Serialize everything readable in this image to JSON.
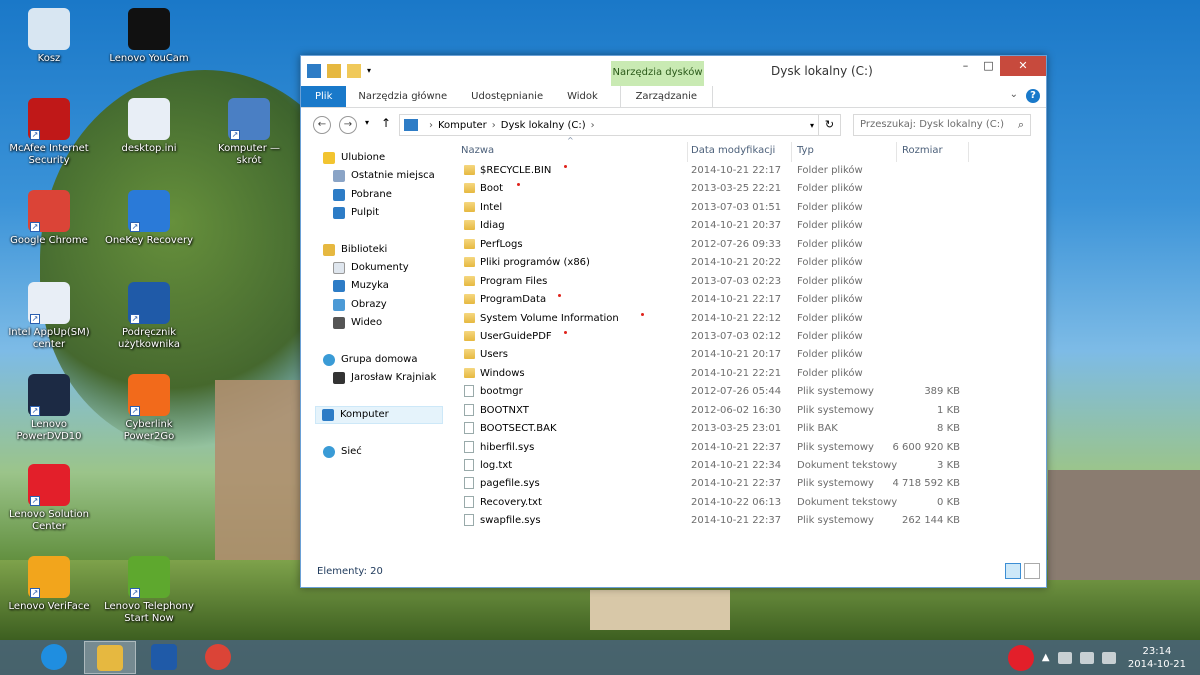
{
  "desktop": {
    "icons": [
      {
        "label": "Kosz",
        "color": "#d8e6f2"
      },
      {
        "label": "Lenovo YouCam",
        "color": "#111111"
      },
      {
        "label": "McAfee Internet Security",
        "color": "#c01818"
      },
      {
        "label": "desktop.ini",
        "color": "#e8eef6"
      },
      {
        "label": "Komputer — skrót",
        "color": "#4a7fc4"
      },
      {
        "label": "Google Chrome",
        "color": "#db4437"
      },
      {
        "label": "OneKey Recovery",
        "color": "#2a7ad8"
      },
      {
        "label": "Intel AppUp(SM) center",
        "color": "#e8eef6"
      },
      {
        "label": "Podręcznik użytkownika",
        "color": "#1f5aa8"
      },
      {
        "label": "Lenovo PowerDVD10",
        "color": "#1c2a44"
      },
      {
        "label": "Cyberlink Power2Go",
        "color": "#f26a1b"
      },
      {
        "label": "Lenovo Solution Center",
        "color": "#e31f2a"
      },
      {
        "label": "Lenovo VeriFace",
        "color": "#f2a51c"
      },
      {
        "label": "Lenovo Telephony Start Now",
        "color": "#5ea82e"
      }
    ]
  },
  "window": {
    "title": "Dysk lokalny (C:)",
    "context_tab_group": "Narzędzia dysków",
    "buttons": {
      "minimize": "–",
      "maximize": "□",
      "close": "✕"
    },
    "ribbon_tabs": [
      "Plik",
      "Narzędzia główne",
      "Udostępnianie",
      "Widok",
      "Zarządzanie"
    ],
    "help": "?",
    "address": {
      "path": [
        "Komputer",
        "Dysk lokalny (C:)"
      ]
    },
    "search_placeholder": "Przeszukaj: Dysk lokalny (C:)",
    "nav": {
      "favorites": "Ulubione",
      "fav_items": [
        "Ostatnie miejsca",
        "Pobrane",
        "Pulpit"
      ],
      "libraries": "Biblioteki",
      "lib_items": [
        "Dokumenty",
        "Muzyka",
        "Obrazy",
        "Wideo"
      ],
      "homegroup": "Grupa domowa",
      "homegroup_user": "Jarosław Krajniak",
      "computer": "Komputer",
      "network": "Sieć"
    },
    "columns": {
      "name": "Nazwa",
      "date": "Data modyfikacji",
      "type": "Typ",
      "size": "Rozmiar"
    },
    "files": [
      {
        "name": "$RECYCLE.BIN",
        "date": "2014-10-21 22:17",
        "type": "Folder plików",
        "size": "",
        "kind": "folder",
        "mark": true
      },
      {
        "name": "Boot",
        "date": "2013-03-25 22:21",
        "type": "Folder plików",
        "size": "",
        "kind": "folder",
        "mark": true
      },
      {
        "name": "Intel",
        "date": "2013-07-03 01:51",
        "type": "Folder plików",
        "size": "",
        "kind": "folder",
        "mark": false
      },
      {
        "name": "Idiag",
        "date": "2014-10-21 20:37",
        "type": "Folder plików",
        "size": "",
        "kind": "folder",
        "mark": false
      },
      {
        "name": "PerfLogs",
        "date": "2012-07-26 09:33",
        "type": "Folder plików",
        "size": "",
        "kind": "folder",
        "mark": false
      },
      {
        "name": "Pliki programów (x86)",
        "date": "2014-10-21 20:22",
        "type": "Folder plików",
        "size": "",
        "kind": "folder",
        "mark": false
      },
      {
        "name": "Program Files",
        "date": "2013-07-03 02:23",
        "type": "Folder plików",
        "size": "",
        "kind": "folder",
        "mark": false
      },
      {
        "name": "ProgramData",
        "date": "2014-10-21 22:17",
        "type": "Folder plików",
        "size": "",
        "kind": "folder",
        "mark": true
      },
      {
        "name": "System Volume Information",
        "date": "2014-10-21 22:12",
        "type": "Folder plików",
        "size": "",
        "kind": "folder",
        "mark": true
      },
      {
        "name": "UserGuidePDF",
        "date": "2013-07-03 02:12",
        "type": "Folder plików",
        "size": "",
        "kind": "folder",
        "mark": true
      },
      {
        "name": "Users",
        "date": "2014-10-21 20:17",
        "type": "Folder plików",
        "size": "",
        "kind": "folder",
        "mark": false
      },
      {
        "name": "Windows",
        "date": "2014-10-21 22:21",
        "type": "Folder plików",
        "size": "",
        "kind": "folder",
        "mark": false
      },
      {
        "name": "bootmgr",
        "date": "2012-07-26 05:44",
        "type": "Plik systemowy",
        "size": "389 KB",
        "kind": "file",
        "mark": false
      },
      {
        "name": "BOOTNXT",
        "date": "2012-06-02 16:30",
        "type": "Plik systemowy",
        "size": "1 KB",
        "kind": "file",
        "mark": false
      },
      {
        "name": "BOOTSECT.BAK",
        "date": "2013-03-25 23:01",
        "type": "Plik BAK",
        "size": "8 KB",
        "kind": "file",
        "mark": false
      },
      {
        "name": "hiberfil.sys",
        "date": "2014-10-21 22:37",
        "type": "Plik systemowy",
        "size": "6 600 920 KB",
        "kind": "file",
        "mark": false
      },
      {
        "name": "log.txt",
        "date": "2014-10-21 22:34",
        "type": "Dokument tekstowy",
        "size": "3 KB",
        "kind": "file",
        "mark": false
      },
      {
        "name": "pagefile.sys",
        "date": "2014-10-21 22:37",
        "type": "Plik systemowy",
        "size": "4 718 592 KB",
        "kind": "file",
        "mark": false
      },
      {
        "name": "Recovery.txt",
        "date": "2014-10-22 06:13",
        "type": "Dokument tekstowy",
        "size": "0 KB",
        "kind": "file",
        "mark": false
      },
      {
        "name": "swapfile.sys",
        "date": "2014-10-21 22:37",
        "type": "Plik systemowy",
        "size": "262 144 KB",
        "kind": "file",
        "mark": false
      }
    ],
    "status": "Elementy: 20"
  },
  "taskbar": {
    "apps": [
      "ie-icon",
      "explorer-icon",
      "lenovo-icon",
      "chrome-icon"
    ],
    "clock_time": "23:14",
    "clock_date": "2014-10-21"
  }
}
